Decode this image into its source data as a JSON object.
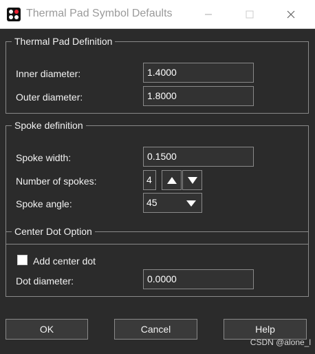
{
  "window": {
    "title": "Thermal Pad Symbol Defaults",
    "icons": {
      "app": "app-icon",
      "minimize": "minimize-icon",
      "maximize": "maximize-icon",
      "close": "close-icon"
    }
  },
  "thermal_pad": {
    "title": "Thermal Pad Definition",
    "inner_label": "Inner diameter:",
    "inner_value": "1.4000",
    "outer_label": "Outer diameter:",
    "outer_value": "1.8000"
  },
  "spoke": {
    "title": "Spoke definition",
    "width_label": "Spoke width:",
    "width_value": "0.1500",
    "count_label": "Number of spokes:",
    "count_value": "4",
    "angle_label": "Spoke angle:",
    "angle_value": "45"
  },
  "center_dot": {
    "title": "Center Dot Option",
    "add_label": "Add center dot",
    "add_checked": false,
    "dot_label": "Dot diameter:",
    "dot_value": "0.0000"
  },
  "buttons": {
    "ok": "OK",
    "cancel": "Cancel",
    "help": "Help"
  },
  "watermark": "CSDN @alone_l"
}
